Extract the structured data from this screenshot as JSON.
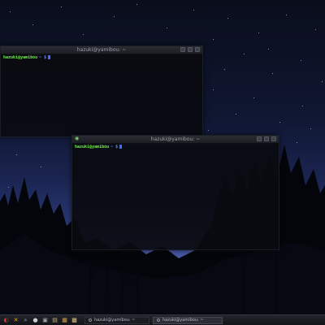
{
  "windows": [
    {
      "title": "hazuki@yamibou: ~",
      "prompt_user": "hazuki@yamibou",
      "prompt_path": "~ $"
    },
    {
      "title": "hazuki@yamibou: ~",
      "prompt_user": "hazuki@yamibou",
      "prompt_path": "~ $"
    }
  ],
  "taskbar": {
    "launchers": [
      {
        "icon": "system-menu-icon",
        "glyph": "◐",
        "color": "#d23a2a"
      },
      {
        "icon": "tools-icon",
        "glyph": "✕",
        "color": "#f0a020"
      },
      {
        "icon": "search-icon",
        "glyph": "🔍",
        "color": "#8fb0e0"
      },
      {
        "icon": "browser-icon",
        "glyph": "●",
        "color": "#c8ccd4"
      },
      {
        "icon": "terminal-icon",
        "glyph": "▣",
        "color": "#9aa0a8"
      },
      {
        "icon": "file-manager-icon",
        "glyph": "▤",
        "color": "#c9b27a"
      },
      {
        "icon": "image-viewer-icon",
        "glyph": "▦",
        "color": "#d8a040"
      },
      {
        "icon": "media-icon",
        "glyph": "▩",
        "color": "#e0c070"
      }
    ],
    "tasks": [
      {
        "label": "hazuki@yamibou: ~",
        "active": false
      },
      {
        "label": "hazuki@yamibou: ~",
        "active": true
      }
    ]
  }
}
